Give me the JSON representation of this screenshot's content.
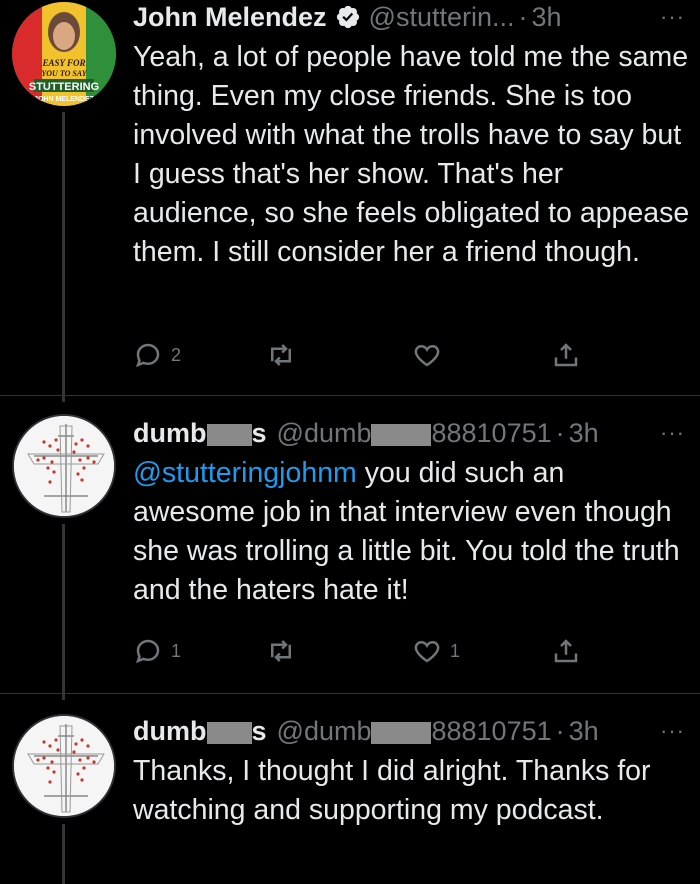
{
  "tweets": [
    {
      "name": "John Melendez",
      "handle": "@stutterin...",
      "time": "3h",
      "more": "···",
      "avatar_text": [
        "EASY FOR",
        "YOU TO SAY",
        "STUTTERING",
        "JOHN MELENDEZ"
      ],
      "text": "Yeah, a lot of people have told me the same thing. Even my close friends. She is too involved with what the trolls have to say but I guess that's her show. That's her audience, so she feels obligated to appease them. I still consider her a friend though.",
      "reply_count": "2",
      "retweet_count": "",
      "like_count": ""
    },
    {
      "name_prefix": "dumb",
      "name_suffix": "s",
      "handle_prefix": "@dumb",
      "handle_suffix": "88810751",
      "time": "3h",
      "more": "···",
      "mention": "@stutteringjohnm",
      "text": " you did such an awesome job in that interview even though she was trolling a little bit. You told the truth and the haters hate it!",
      "reply_count": "1",
      "retweet_count": "",
      "like_count": "1"
    },
    {
      "name_prefix": "dumb",
      "name_suffix": "s",
      "handle_prefix": "@dumb",
      "handle_suffix": "88810751",
      "time": "3h",
      "more": "···",
      "text": "Thanks, I thought I did alright. Thanks for watching and supporting my podcast."
    }
  ],
  "colors": {
    "background": "#000000",
    "text": "#e7e9ea",
    "secondary": "#71767b",
    "link": "#1d9bf0",
    "verified": "#1d9bf0"
  }
}
